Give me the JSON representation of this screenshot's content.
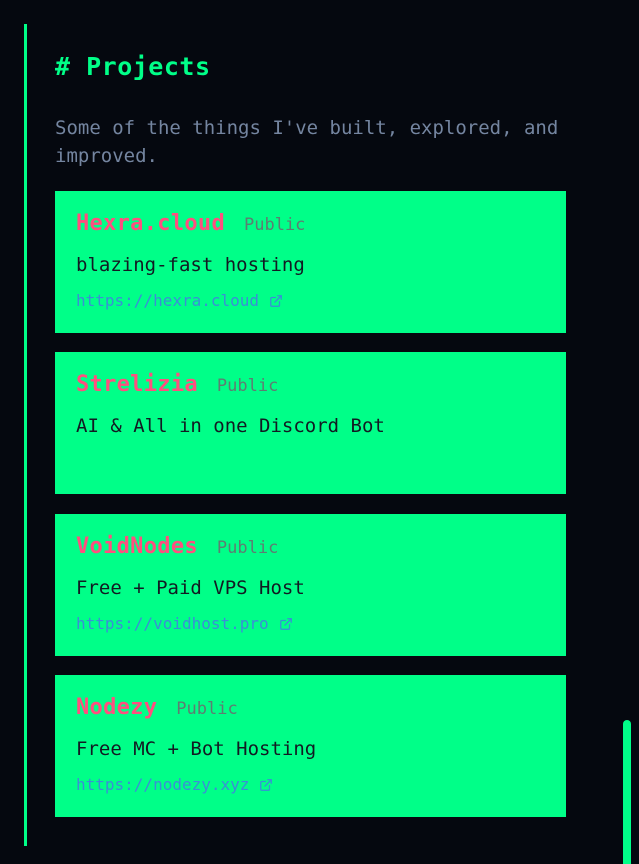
{
  "section": {
    "title": "# Projects",
    "subtitle": "Some of the things I've built, explored, and improved."
  },
  "projects": [
    {
      "name": "Hexra.cloud",
      "badge": "Public",
      "description": "blazing-fast hosting",
      "link": "https://hexra.cloud"
    },
    {
      "name": "Strelizia",
      "badge": "Public",
      "description": "AI & All in one Discord Bot",
      "link": ""
    },
    {
      "name": "VoidNodes",
      "badge": "Public",
      "description": "Free + Paid VPS Host",
      "link": "https://voidhost.pro"
    },
    {
      "name": "Nodezy",
      "badge": "Public",
      "description": "Free MC + Bot Hosting",
      "link": "https://nodezy.xyz"
    }
  ],
  "colors": {
    "background": "#05080f",
    "accent": "#00ff88",
    "project_name": "#ff4f7f",
    "link": "#3a8fd6",
    "muted_text": "#7485a0"
  },
  "icons": {
    "link_icon": "external-link-icon"
  }
}
